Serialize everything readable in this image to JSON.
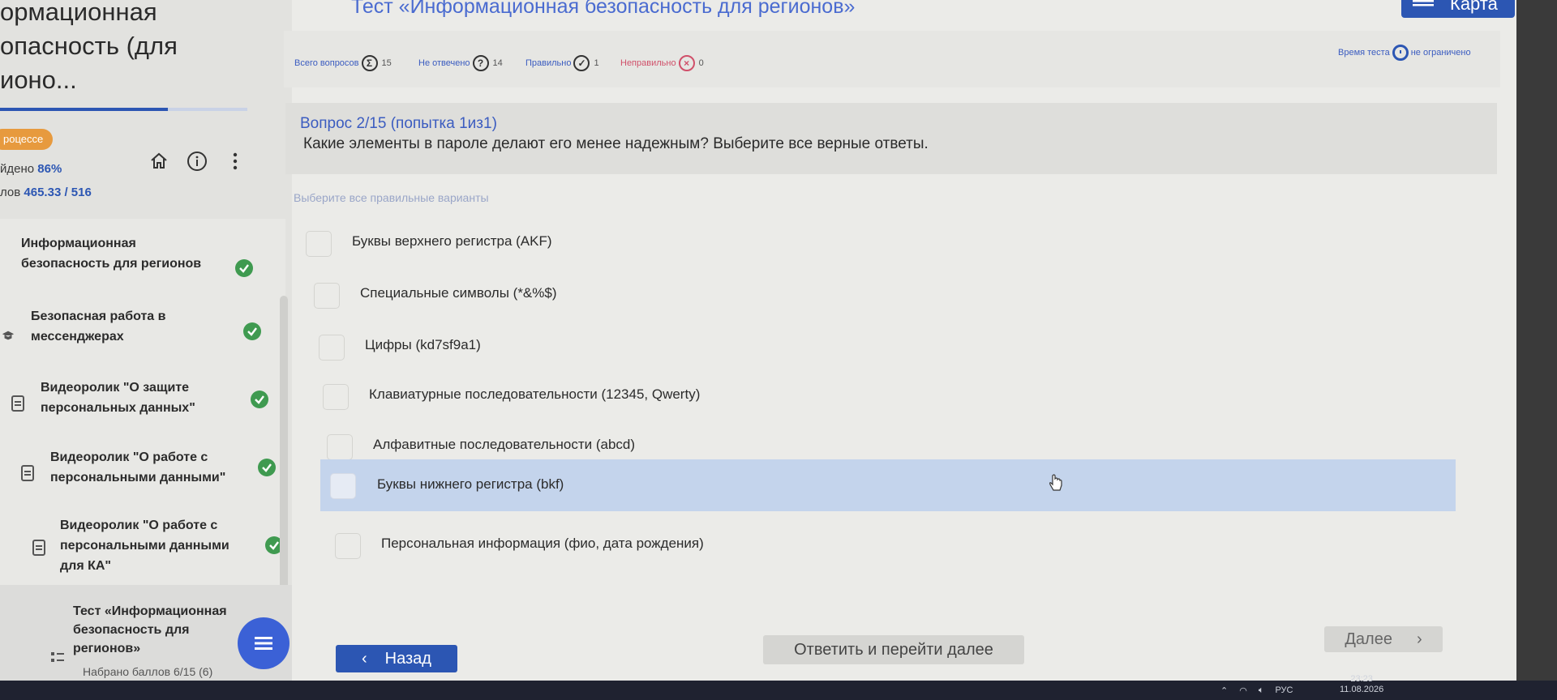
{
  "course": {
    "title": "ормационная\nопасность (для\nионо..."
  },
  "sidebar": {
    "progress_fraction": 0.68,
    "status_label": "роцессе",
    "done_label": "йдено",
    "done_value": "86%",
    "points_label": "лов",
    "points_value": "465.33 / 516",
    "items": [
      {
        "label": "Информационная\nбезопасность для регионов",
        "done": true
      },
      {
        "label": "Безопасная работа в\nмессенджерах",
        "done": true
      },
      {
        "label": "Видеоролик \"О защите\nперсональных данных\"",
        "done": true
      },
      {
        "label": "Видеоролик \"О работе с\nперсональными данными\"",
        "done": true
      },
      {
        "label": "Видеоролик \"О работе с\nперсональными данными\nдля КА\"",
        "done": true
      }
    ],
    "current_item": {
      "label": "Тест «Информационная\nбезопасность для\nрегионов»",
      "score": "Набрано баллов 6/15 (6)"
    }
  },
  "header": {
    "title": "Тест «Информационная безопасность для регионов»",
    "map_label": "Карта"
  },
  "stats": {
    "total_label": "Всего вопросов",
    "total_value": "15",
    "unanswered_label": "Не отвечено",
    "unanswered_value": "14",
    "correct_label": "Правильно",
    "correct_value": "1",
    "wrong_label": "Неправильно",
    "wrong_value": "0",
    "time_label": "Время теста",
    "time_value": "не ограничено"
  },
  "question": {
    "number": "Вопрос 2/15  (попытка 1из1)",
    "text": "Какие элементы в пароле делают его менее надежным? Выберите все верные ответы.",
    "hint": "Выберите все правильные варианты",
    "options": [
      "Буквы верхнего регистра (AKF)",
      "Специальные символы (*&%$)",
      "Цифры (kd7sf9a1)",
      "Клавиатурные последовательности (12345, Qwerty)",
      "Алфавитные последовательности (abcd)",
      "Буквы нижнего регистра (bkf)",
      "Персональная информация (фио, дата рождения)"
    ]
  },
  "footer": {
    "back_label": "Назад",
    "answer_label": "Ответить и перейти далее",
    "next_label": "Далее"
  },
  "taskbar": {
    "lang": "РУС",
    "time": "23:23",
    "date": "11.08.2026"
  }
}
